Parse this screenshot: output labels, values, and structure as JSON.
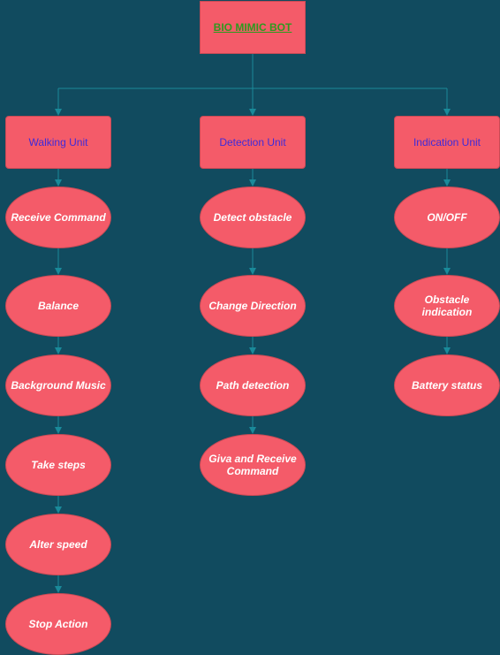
{
  "colors": {
    "background": "#114b5f",
    "node_fill": "#f45b69",
    "connector": "#1a8a9a",
    "title_text": "#2e9a1f",
    "unit_text": "#3f2bd9",
    "ellipse_text": "#ffffff"
  },
  "root": {
    "label": "BIO MIMIC BOT"
  },
  "units": [
    {
      "label": "Walking Unit",
      "items": [
        "Receive Command",
        "Balance",
        "Background Music",
        "Take steps",
        "Alter speed",
        "Stop Action"
      ]
    },
    {
      "label": "Detection Unit",
      "items": [
        "Detect obstacle",
        "Change Direction",
        "Path detection",
        "Giva and Receive Command"
      ]
    },
    {
      "label": "Indication Unit",
      "items": [
        "ON/OFF",
        "Obstacle indication",
        "Battery status"
      ]
    }
  ]
}
